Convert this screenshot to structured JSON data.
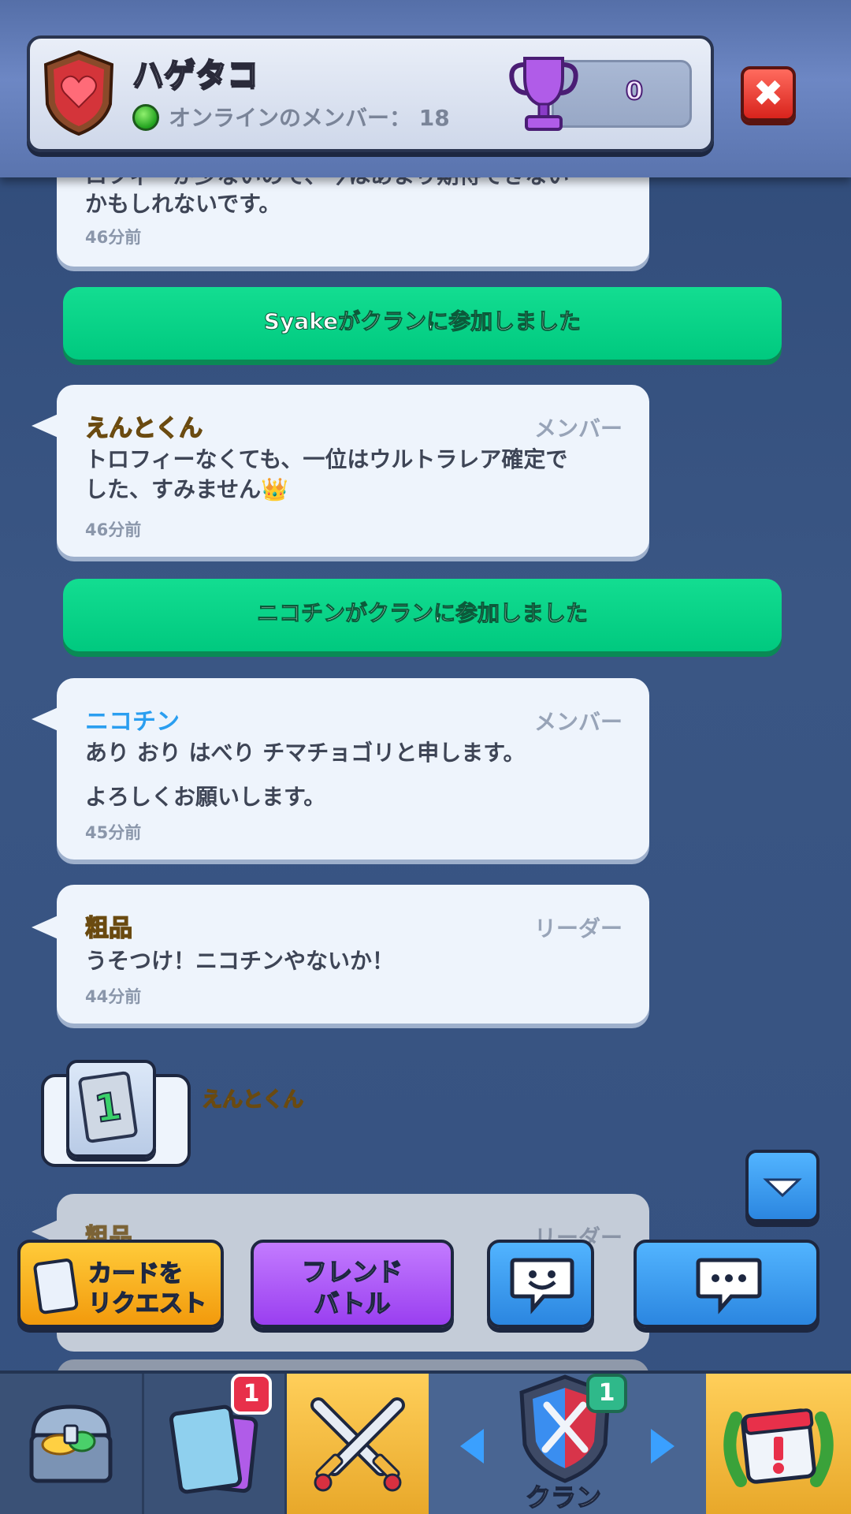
{
  "header": {
    "clan_name": "ハゲタコ",
    "online_label": "オンラインのメンバー： 18",
    "trophy_count": "0",
    "close_icon": "close-x-icon",
    "badge_icon": "heart-shield-icon",
    "trophy_icon": "purple-trophy-icon"
  },
  "chat": {
    "partial_message": {
      "text_line1": "ロフィーが少ないので、今はあまり期待できない",
      "text_line2": "かもしれないです。",
      "time": "46分前"
    },
    "system_1": "Syakeがクランに参加しました",
    "message_1": {
      "sender": "えんとくん",
      "role": "メンバー",
      "text_line1": "トロフィーなくても、一位はウルトラレア確定で",
      "text_line2": "した、すみません👑",
      "time": "46分前"
    },
    "system_2": "ニコチンがクランに参加しました",
    "message_2": {
      "sender": "ニコチン",
      "role": "メンバー",
      "text_line1": "あり おり はべり チマチョゴリと申します。",
      "text_line2": "よろしくお願いします。",
      "time": "45分前"
    },
    "message_3": {
      "sender": "粗品",
      "role": "リーダー",
      "text_line1": "うそつけ！ニコチンやないか！",
      "time": "44分前"
    },
    "card_request": {
      "sender": "えんとくん",
      "count": "1"
    },
    "message_4_partial": {
      "sender": "粗品",
      "role": "リーダー"
    }
  },
  "scroll_down_icon": "chevron-down-icon",
  "actions": {
    "request_line1": "カードを",
    "request_line2": "リクエスト",
    "friend_battle_line1": "フレンド",
    "friend_battle_line2": "バトル",
    "emote_icon": "smiley-speech-icon",
    "chat_icon": "speech-bubble-icon"
  },
  "nav": {
    "shop_icon": "treasure-chest-icon",
    "cards_badge": "1",
    "cards_icon": "cards-icon",
    "battle_icon": "crossed-swords-icon",
    "clan_label": "クラン",
    "clan_badge": "1",
    "clan_icon": "clan-shield-icon",
    "events_icon": "event-calendar-icon"
  },
  "colors": {
    "system_green": "#00c97f",
    "request_yellow": "#f7ae1a",
    "friend_purple": "#a24cf0",
    "chat_blue": "#2f8fe6",
    "close_red": "#d8231c"
  }
}
